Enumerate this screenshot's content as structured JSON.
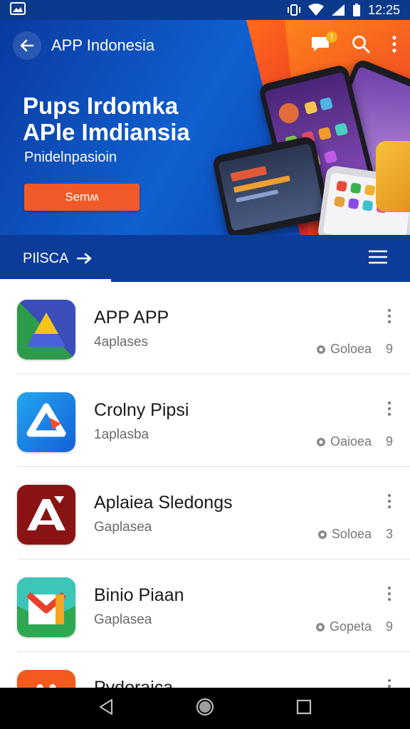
{
  "status": {
    "time": "12:25"
  },
  "header": {
    "title": "APP Indonesia",
    "notification_count": "!"
  },
  "hero": {
    "title_line1": "Pups Irdomka",
    "title_line2": "APle Imdiansia",
    "subtitle": "Pnidelnpasioin",
    "button_label": "Semʍ"
  },
  "tabbar": {
    "label": "PIlSCA"
  },
  "apps": [
    {
      "name": "APP APP",
      "subtitle": "4aplases",
      "meta_label": "Goloea",
      "meta_value": "9"
    },
    {
      "name": "Crolny Pipsi",
      "subtitle": "1aplasba",
      "meta_label": "Oaioea",
      "meta_value": "9"
    },
    {
      "name": "Aplaiea Sledongs",
      "subtitle": "Gaplasea",
      "meta_label": "Soloea",
      "meta_value": "3"
    },
    {
      "name": "Binio Piaan",
      "subtitle": "Gaplasea",
      "meta_label": "Gopeta",
      "meta_value": "9"
    },
    {
      "name": "Pydoraica",
      "subtitle": "",
      "meta_label": "",
      "meta_value": ""
    }
  ],
  "colors": {
    "primary": "#0b3c9a",
    "accent": "#f05a28"
  }
}
